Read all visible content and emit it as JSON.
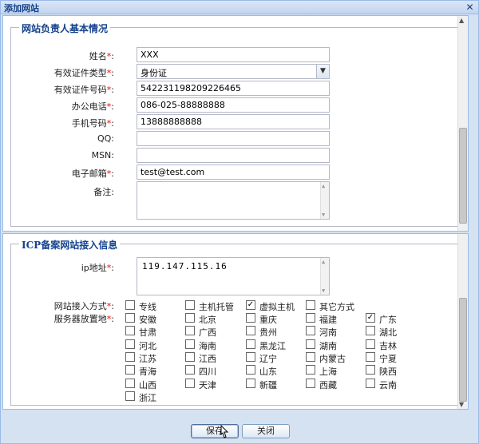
{
  "window": {
    "title": "添加网站",
    "close_icon": "✕"
  },
  "section1": {
    "legend": "网站负责人基本情况",
    "fields": [
      {
        "label": "姓名",
        "required": true,
        "value": "XXX"
      },
      {
        "label": "有效证件类型",
        "required": true,
        "value": "身份证",
        "type": "select"
      },
      {
        "label": "有效证件号码",
        "required": true,
        "value": "542231198209226465"
      },
      {
        "label": "办公电话",
        "required": true,
        "value": "086-025-88888888"
      },
      {
        "label": "手机号码",
        "required": true,
        "value": "13888888888"
      },
      {
        "label": "QQ",
        "required": false,
        "value": ""
      },
      {
        "label": "MSN",
        "required": false,
        "value": ""
      },
      {
        "label": "电子邮箱",
        "required": true,
        "value": "test@test.com"
      },
      {
        "label": "备注",
        "required": false,
        "value": "",
        "type": "textarea"
      }
    ]
  },
  "section2": {
    "legend": "ICP备案网站接入信息",
    "ip": {
      "label": "ip地址",
      "required": true,
      "value": "119.147.115.16"
    },
    "access": {
      "label": "网站接入方式",
      "required": true,
      "options": [
        {
          "label": "专线",
          "checked": false
        },
        {
          "label": "主机托管",
          "checked": false
        },
        {
          "label": "虚拟主机",
          "checked": true
        },
        {
          "label": "其它方式",
          "checked": false
        }
      ]
    },
    "location": {
      "label": "服务器放置地",
      "required": true,
      "options": [
        {
          "label": "安徽",
          "checked": false
        },
        {
          "label": "北京",
          "checked": false
        },
        {
          "label": "重庆",
          "checked": false
        },
        {
          "label": "福建",
          "checked": false
        },
        {
          "label": "广东",
          "checked": true
        },
        {
          "label": "甘肃",
          "checked": false
        },
        {
          "label": "广西",
          "checked": false
        },
        {
          "label": "贵州",
          "checked": false
        },
        {
          "label": "河南",
          "checked": false
        },
        {
          "label": "湖北",
          "checked": false
        },
        {
          "label": "河北",
          "checked": false
        },
        {
          "label": "海南",
          "checked": false
        },
        {
          "label": "黑龙江",
          "checked": false
        },
        {
          "label": "湖南",
          "checked": false
        },
        {
          "label": "吉林",
          "checked": false
        },
        {
          "label": "江苏",
          "checked": false
        },
        {
          "label": "江西",
          "checked": false
        },
        {
          "label": "辽宁",
          "checked": false
        },
        {
          "label": "内蒙古",
          "checked": false
        },
        {
          "label": "宁夏",
          "checked": false
        },
        {
          "label": "青海",
          "checked": false
        },
        {
          "label": "四川",
          "checked": false
        },
        {
          "label": "山东",
          "checked": false
        },
        {
          "label": "上海",
          "checked": false
        },
        {
          "label": "陕西",
          "checked": false
        },
        {
          "label": "山西",
          "checked": false
        },
        {
          "label": "天津",
          "checked": false
        },
        {
          "label": "新疆",
          "checked": false
        },
        {
          "label": "西藏",
          "checked": false
        },
        {
          "label": "云南",
          "checked": false
        },
        {
          "label": "浙江",
          "checked": false
        }
      ]
    }
  },
  "buttons": {
    "save": "保存",
    "close": "关闭"
  },
  "label_suffix": ":"
}
